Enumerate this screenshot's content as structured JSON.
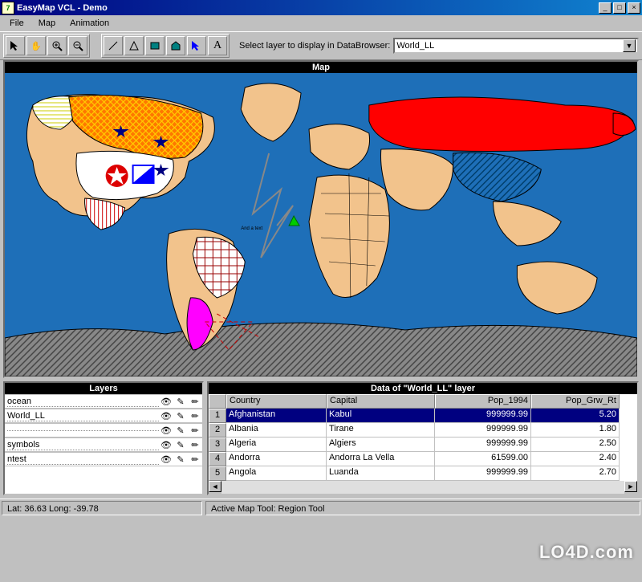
{
  "window": {
    "title": "EasyMap VCL - Demo"
  },
  "menu": {
    "items": [
      "File",
      "Map",
      "Animation"
    ]
  },
  "toolbar": {
    "group1": [
      "pointer",
      "pan",
      "zoom-in",
      "zoom-out"
    ],
    "group2": [
      "line",
      "polygon",
      "rect-fill",
      "home",
      "pointer-blue",
      "text"
    ]
  },
  "layer_select": {
    "label": "Select layer to display in DataBrowser:",
    "value": "World_LL"
  },
  "map": {
    "title": "Map"
  },
  "layers_panel": {
    "title": "Layers",
    "rows": [
      {
        "name": "ocean"
      },
      {
        "name": "World_LL"
      },
      {
        "name": ""
      },
      {
        "name": "symbols"
      },
      {
        "name": "ntest"
      }
    ]
  },
  "data_panel": {
    "title": "Data of \"World_LL\" layer",
    "columns": [
      "Country",
      "Capital",
      "Pop_1994",
      "Pop_Grw_Rt"
    ],
    "rows": [
      {
        "n": "1",
        "country": "Afghanistan",
        "capital": "Kabul",
        "pop": "999999.99",
        "grw": "5.20",
        "selected": true
      },
      {
        "n": "2",
        "country": "Albania",
        "capital": "Tirane",
        "pop": "999999.99",
        "grw": "1.80"
      },
      {
        "n": "3",
        "country": "Algeria",
        "capital": "Algiers",
        "pop": "999999.99",
        "grw": "2.50"
      },
      {
        "n": "4",
        "country": "Andorra",
        "capital": "Andorra La Vella",
        "pop": "61599.00",
        "grw": "2.40"
      },
      {
        "n": "5",
        "country": "Angola",
        "capital": "Luanda",
        "pop": "999999.99",
        "grw": "2.70"
      }
    ]
  },
  "status": {
    "coords": "Lat: 36.63 Long: -39.78",
    "tool": "Active Map Tool: Region Tool"
  },
  "watermark": "LO4D.com"
}
